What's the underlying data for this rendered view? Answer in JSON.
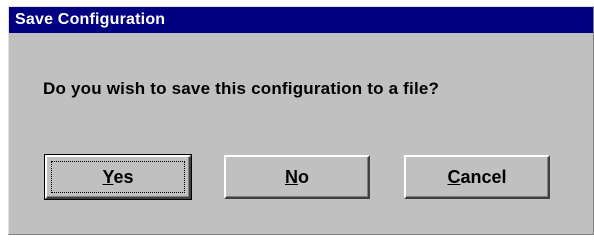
{
  "window": {
    "title": "Save Configuration"
  },
  "dialog": {
    "message": "Do you wish to save this configuration to a file?"
  },
  "buttons": {
    "yes": {
      "mnemonic": "Y",
      "rest": "es"
    },
    "no": {
      "mnemonic": "N",
      "rest": "o"
    },
    "cancel": {
      "mnemonic": "C",
      "rest": "ancel"
    }
  },
  "colors": {
    "titlebar": "#000080",
    "face": "#c0c0c0",
    "title_text": "#ffffff"
  }
}
